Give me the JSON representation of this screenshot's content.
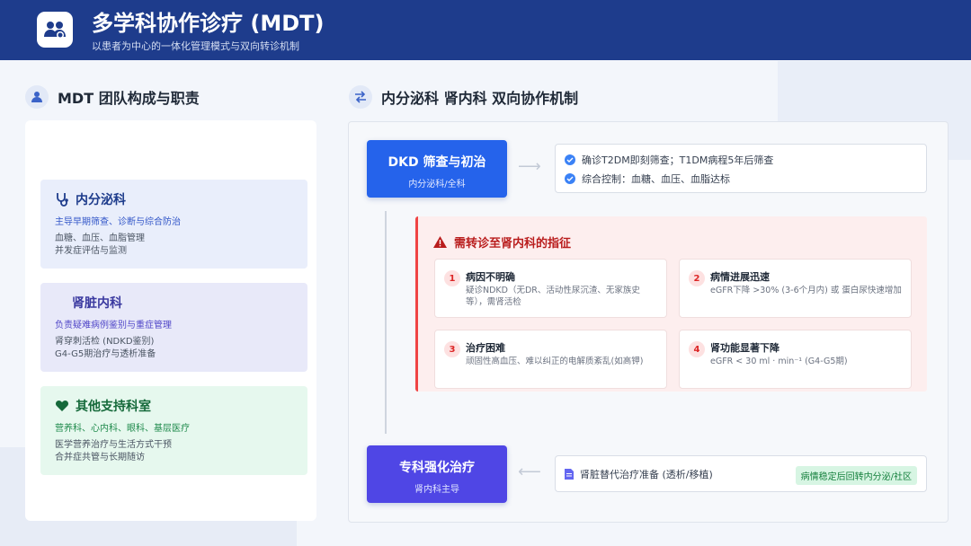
{
  "header": {
    "title": "多学科协作诊疗 (MDT)",
    "subtitle": "以患者为中心的一体化管理模式与双向转诊机制"
  },
  "left_section": {
    "title": "MDT 团队构成与职责",
    "departments": [
      {
        "name": "内分泌科",
        "role": "主导早期筛查、诊断与综合防治",
        "details": [
          "血糖、血压、血脂管理",
          "并发症评估与监测"
        ],
        "icon": "stethoscope-icon"
      },
      {
        "name": "肾脏内科",
        "role": "负责疑难病例鉴别与重症管理",
        "details": [
          "肾穿刺活检 (NDKD鉴别)",
          "G4-G5期治疗与透析准备"
        ],
        "icon": "kidney-icon"
      },
      {
        "name": "其他支持科室",
        "role": "营养科、心内科、眼科、基层医疗",
        "details": [
          "医学营养治疗与生活方式干预",
          "合并症共管与长期随访"
        ],
        "icon": "heart-icon"
      }
    ]
  },
  "right_section": {
    "title": "内分泌科 肾内科 双向协作机制",
    "step1": {
      "title": "DKD 筛查与初治",
      "subtitle": "内分泌科/全科",
      "checks": [
        "确诊T2DM即刻筛查；T1DM病程5年后筛查",
        "综合控制：血糖、血压、血脂达标"
      ]
    },
    "referral": {
      "title": "需转诊至肾内科的指征",
      "items": [
        {
          "num": "1",
          "title": "病因不明确",
          "desc": "疑诊NDKD（无DR、活动性尿沉渣、无家族史等），需肾活检"
        },
        {
          "num": "2",
          "title": "病情进展迅速",
          "desc": "eGFR下降 >30% (3-6个月内) 或 蛋白尿快速增加"
        },
        {
          "num": "3",
          "title": "治疗困难",
          "desc": "顽固性高血压、难以纠正的电解质紊乱(如高钾)"
        },
        {
          "num": "4",
          "title": "肾功能显著下降",
          "desc": "eGFR < 30 ml · min⁻¹ (G4-G5期)"
        }
      ]
    },
    "step2": {
      "title": "专科强化治疗",
      "subtitle": "肾内科主导",
      "note": "肾脏替代治疗准备 (透析/移植)",
      "badge": "病情稳定后回转内分泌/社区"
    }
  },
  "colors": {
    "header": "#1e3c8c",
    "step1": "#2563eb",
    "step2": "#4f46e5",
    "warning": "#ef4444"
  }
}
